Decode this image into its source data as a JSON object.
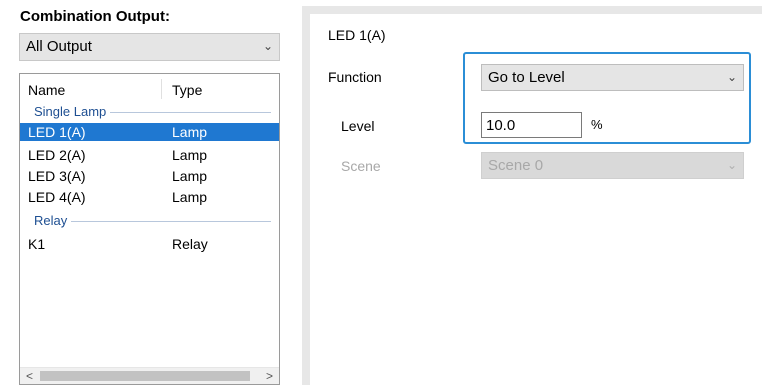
{
  "left": {
    "title": "Combination Output:",
    "filter": {
      "selected": "All Output"
    },
    "list": {
      "columns": {
        "name": "Name",
        "type": "Type"
      },
      "groups": [
        {
          "label": "Single Lamp",
          "items": [
            {
              "name": "LED 1(A)",
              "type": "Lamp",
              "selected": true
            },
            {
              "name": "LED 2(A)",
              "type": "Lamp"
            },
            {
              "name": "LED 3(A)",
              "type": "Lamp"
            },
            {
              "name": "LED 4(A)",
              "type": "Lamp"
            }
          ]
        },
        {
          "label": "Relay",
          "items": [
            {
              "name": "K1",
              "type": "Relay"
            }
          ]
        }
      ]
    },
    "scroll_left": "<",
    "scroll_right": ">"
  },
  "right": {
    "header": "LED 1(A)",
    "function_label": "Function",
    "function_value": "Go to Level",
    "level_label": "Level",
    "level_value": "10.0",
    "level_unit": "%",
    "scene_label": "Scene",
    "scene_value": "Scene 0"
  },
  "icons": {
    "dropdown": "chevron-down-icon"
  },
  "colors": {
    "selection": "#1f78d1",
    "focus_border": "#2b8ed6",
    "group_label": "#1e4f92"
  }
}
